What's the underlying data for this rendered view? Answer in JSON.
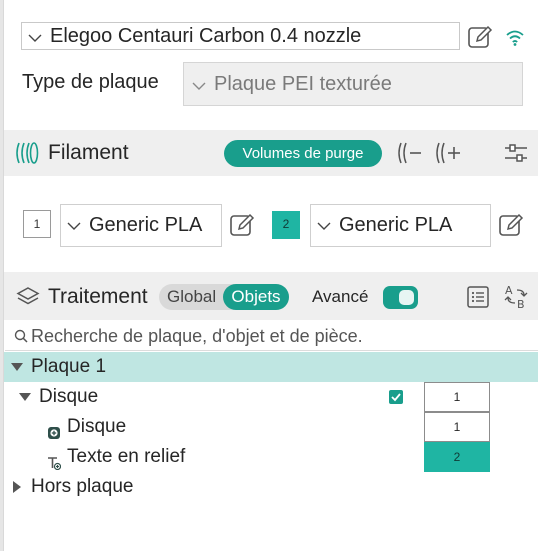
{
  "printer": {
    "preset": "Elegoo Centauri Carbon 0.4 nozzle"
  },
  "plate": {
    "label": "Type de plaque",
    "value": "Plaque PEI texturée"
  },
  "filament": {
    "title": "Filament",
    "purge_button": "Volumes de purge",
    "slots": [
      {
        "number": "1",
        "material": "Generic PLA"
      },
      {
        "number": "2",
        "material": "Generic PLA",
        "color": "#1fb5a3"
      }
    ]
  },
  "process": {
    "title": "Traitement",
    "seg_global": "Global",
    "seg_objects": "Objets",
    "advanced_label": "Avancé",
    "advanced_on": true
  },
  "search": {
    "placeholder": "Recherche de plaque, d'objet et de pièce."
  },
  "tree": {
    "plate": "Plaque 1",
    "object": {
      "name": "Disque",
      "extruder": "1"
    },
    "parts": [
      {
        "name": "Disque",
        "extruder": "1"
      },
      {
        "name": "Texte en relief",
        "extruder": "2"
      }
    ],
    "outside": "Hors plaque"
  },
  "colors": {
    "accent": "#199e8c",
    "filament2": "#1fb5a3",
    "selection": "#bfe6e2"
  }
}
